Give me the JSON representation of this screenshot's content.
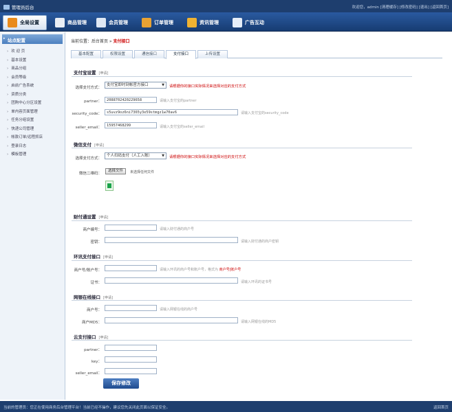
{
  "app": {
    "title": "管理员后台"
  },
  "top_links": "欢迎您，admin [清理缓存] [修改密码] [退出] [返回首页]",
  "nav": [
    {
      "label": "全局设置",
      "active": true
    },
    {
      "label": "商品管理"
    },
    {
      "label": "会员管理"
    },
    {
      "label": "订单管理"
    },
    {
      "label": "资讯管理"
    },
    {
      "label": "广告互动"
    }
  ],
  "sidebar": {
    "title": "站点配置",
    "items": [
      "欢 迎 页",
      "基本设置",
      "商品分组",
      "会员等级",
      "启前广告系统",
      "资质分类",
      "团购中心分区设置",
      "单内容页面管理",
      "任务分组设置",
      "快递公司管理",
      "帐款订单/远程抓店",
      "登录日志",
      "模板管理"
    ]
  },
  "breadcrumb": {
    "prefix": "当前位置：后台首页 »",
    "current": "支付接口"
  },
  "tabs": [
    "基本配置",
    "权限设置",
    "通信接口",
    "支付接口",
    "上传设置"
  ],
  "active_tab": 3,
  "alipay": {
    "title": "支付宝设置",
    "note": "[申请]",
    "method_label": "选择支付方式：",
    "method_value": "支付宝即时到帐官方接口",
    "method_warn": "请根据你的接口实际情况来选择对应的支付方式",
    "partner_label": "partner：",
    "partner_value": "2088702420229658",
    "partner_hint": "请输入支付宝的partner",
    "code_label": "security_code：",
    "code_value": "s5uvz9oz6ni7365y3e59stmgz1w70av6",
    "code_hint": "请输入支付宝的security_code",
    "email_label": "seller_email：",
    "email_value": "15957468299",
    "email_hint": "请输入支付宝的seller_email"
  },
  "wechat": {
    "title": "微信支付",
    "note": "[申请]",
    "method_label": "选择支付方式：",
    "method_value": "个人扫码支付（人工入账）",
    "method_warn": "请根据你的接口实际情况来选择对应的支付方式",
    "qr_label": "微信二维码：",
    "file_btn": "选择文件",
    "file_status": "未选择任何文件"
  },
  "tenpay": {
    "title": "财付通设置",
    "note": "[申请]",
    "user_label": "商户编号：",
    "user_hint": "请输入财付通的商户号",
    "key_label": "密钥：",
    "key_hint": "请输入财付通的商户密钥"
  },
  "huanxun": {
    "title": "环讯支付接口",
    "note": "[申请]",
    "id_label": "商户号/账户号：",
    "id_hint": "请输入环讯的商户号和账户号，格式为",
    "id_format": "商户号|账户号",
    "cert_label": "证书：",
    "cert_hint": "请输入环讯的证书号"
  },
  "netbank": {
    "title": "网银在线接口",
    "note": "[申请]",
    "id_label": "商户号：",
    "id_hint": "请输入网银在线的商户号",
    "key_label": "商户MD5：",
    "key_hint": "请输入网银在线的MD5"
  },
  "cloudpay": {
    "title": "云支付接口",
    "note": "[申请]",
    "partner_label": "partner：",
    "key_label": "key：",
    "email_label": "seller_email："
  },
  "save_label": "保存修改",
  "footer": {
    "left": "当前的管理员：您正在使用商务后台管理平台！当前已经不操作，建议您先关闭此页面以保证安全。",
    "right": "返回首页"
  }
}
